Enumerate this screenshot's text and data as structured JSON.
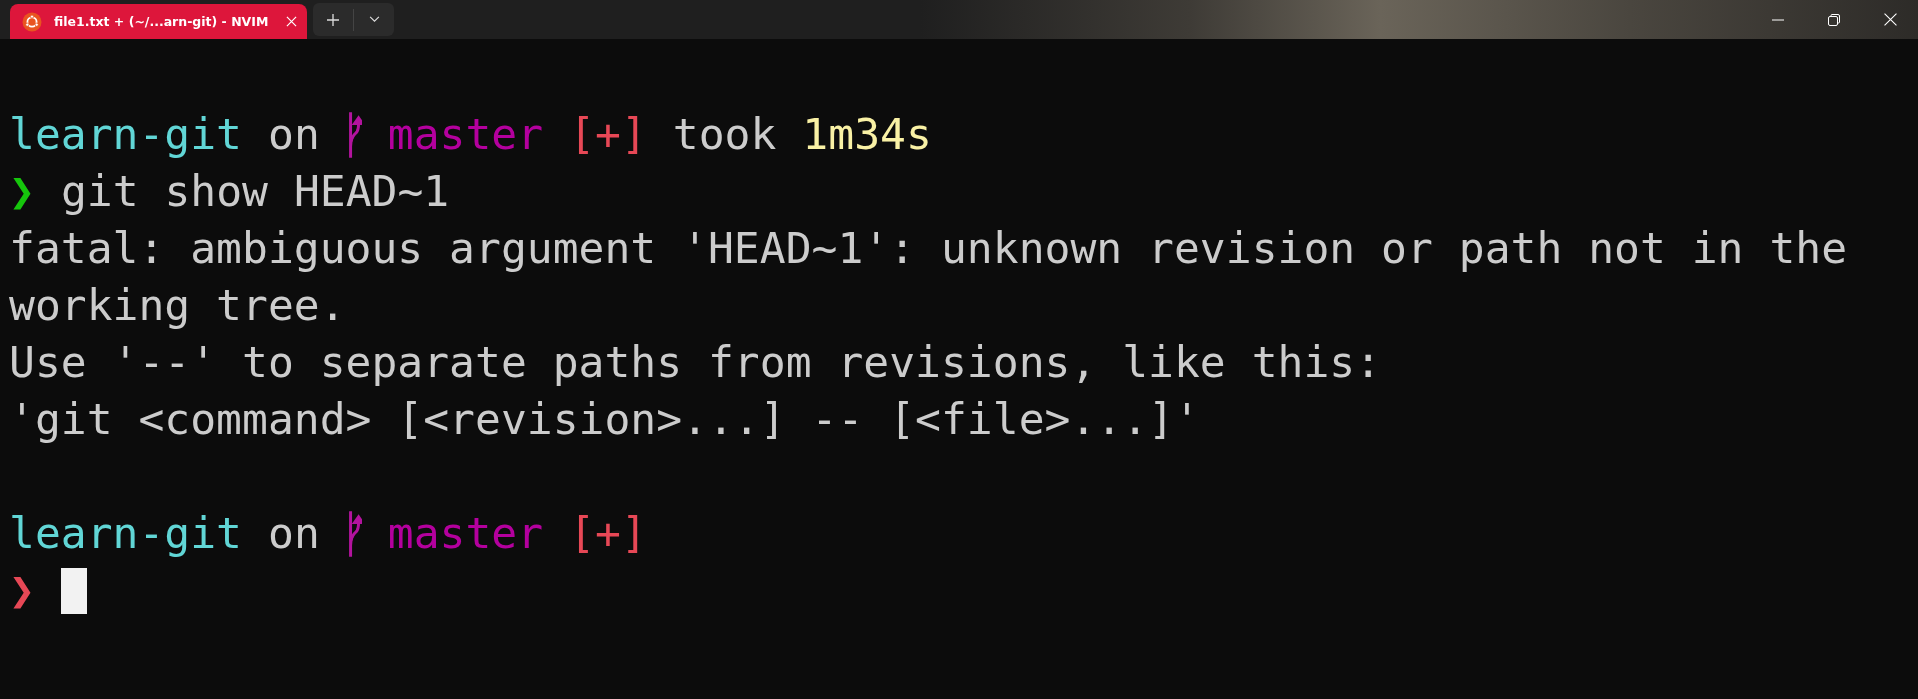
{
  "window": {
    "tab": {
      "title": "file1.txt + (~/...arn-git) - NVIM",
      "selected": true
    }
  },
  "terminal": {
    "lines": [
      {
        "kind": "prompt",
        "segments": [
          {
            "kind": "directory",
            "text": "learn-git"
          },
          {
            "kind": "plain",
            "text": "on"
          },
          {
            "kind": "branch_icon"
          },
          {
            "kind": "branch",
            "text": "master"
          },
          {
            "kind": "status",
            "text": "[+]"
          },
          {
            "kind": "plain",
            "text": "took"
          },
          {
            "kind": "duration",
            "text": "1m34s"
          }
        ]
      },
      {
        "kind": "input",
        "segments": [
          {
            "kind": "prompt",
            "success": true,
            "text": "❯"
          },
          {
            "kind": "command",
            "text": "git show HEAD~1"
          }
        ]
      },
      {
        "kind": "output",
        "segments": [
          {
            "kind": "output",
            "text": "fatal: ambiguous argument 'HEAD~1': unknown revision or path not in the"
          }
        ]
      },
      {
        "kind": "output",
        "segments": [
          {
            "kind": "output",
            "text": "working tree."
          }
        ]
      },
      {
        "kind": "output",
        "segments": [
          {
            "kind": "output",
            "text": "Use '--' to separate paths from revisions, like this:"
          }
        ]
      },
      {
        "kind": "output",
        "segments": [
          {
            "kind": "output",
            "text": "'git <command> [<revision>...] -- [<file>...]'"
          }
        ]
      },
      {
        "kind": "prompt",
        "segments": [
          {
            "kind": "directory",
            "text": "learn-git"
          },
          {
            "kind": "plain",
            "text": "on"
          },
          {
            "kind": "branch_icon"
          },
          {
            "kind": "branch",
            "text": "master"
          },
          {
            "kind": "status",
            "text": "[+]"
          }
        ]
      },
      {
        "kind": "input",
        "segments": [
          {
            "kind": "prompt",
            "success": false,
            "text": "❯"
          },
          {
            "kind": "cursor"
          }
        ]
      }
    ]
  }
}
